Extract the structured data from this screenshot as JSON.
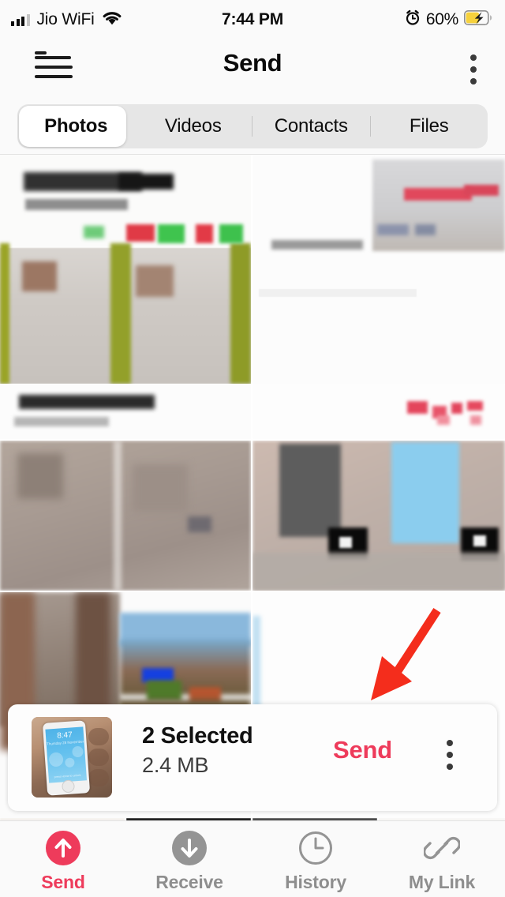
{
  "status_bar": {
    "carrier": "Jio WiFi",
    "time": "7:44 PM",
    "battery_percent": "60%",
    "signal_icon": "signal-bars-icon",
    "wifi_icon": "wifi-icon",
    "alarm_icon": "alarm-clock-icon",
    "battery_icon": "battery-charging-icon"
  },
  "header": {
    "title": "Send",
    "menu_icon": "hamburger-menu-icon",
    "notification_dot": true,
    "overflow_icon": "three-dot-menu-icon"
  },
  "tabs": {
    "items": [
      {
        "label": "Photos",
        "active": true
      },
      {
        "label": "Videos",
        "active": false
      },
      {
        "label": "Contacts",
        "active": false
      },
      {
        "label": "Files",
        "active": false
      }
    ]
  },
  "gallery": {
    "name": "photo-grid",
    "cells": [
      {
        "id": "cell-1",
        "tone": "light-produce"
      },
      {
        "id": "cell-2",
        "tone": "white-document"
      },
      {
        "id": "cell-3",
        "tone": "gray-band"
      },
      {
        "id": "cell-4",
        "tone": "white-blank"
      },
      {
        "id": "cell-5",
        "tone": "brown-gray"
      },
      {
        "id": "cell-6",
        "tone": "dark-gray-blue"
      },
      {
        "id": "cell-7",
        "tone": "blue-scene"
      },
      {
        "id": "cell-8",
        "tone": "white-blank"
      }
    ]
  },
  "annotation": {
    "arrow": "red-arrow-annotation",
    "color": "#f42d1c"
  },
  "selection_card": {
    "thumbnail": "selected-photo-thumbnail",
    "thumbnail_time": "8:47",
    "thumbnail_date": "Thursday 28 November",
    "thumbnail_footer": "press Home to unlock",
    "count_label": "2 Selected",
    "size_label": "2.4 MB",
    "send_label": "Send",
    "overflow_icon": "three-dot-menu-icon"
  },
  "bottom_nav": {
    "items": [
      {
        "label": "Send",
        "icon": "send-up-arrow-icon",
        "active": true
      },
      {
        "label": "Receive",
        "icon": "receive-down-arrow-icon",
        "active": false
      },
      {
        "label": "History",
        "icon": "clock-icon",
        "active": false
      },
      {
        "label": "My Link",
        "icon": "link-chain-icon",
        "active": false
      }
    ]
  },
  "colors": {
    "accent_red": "#ee3b5b",
    "inactive_gray": "#8e8e8e",
    "icon_gray": "#949494",
    "segment_track": "#e6e6e6",
    "page_bg": "#fafafa"
  }
}
